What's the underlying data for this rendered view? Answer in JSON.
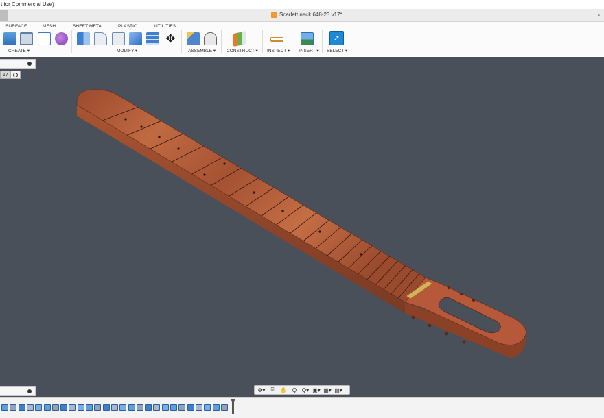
{
  "window": {
    "title_strip": "t for Commercial Use)",
    "doc_title": "Scarlett neck 648-23 v17*",
    "close_glyph": "×"
  },
  "toolbar": {
    "tabs": [
      "SURFACE",
      "MESH",
      "SHEET METAL",
      "PLASTIC",
      "UTILITIES"
    ],
    "groups": [
      "CREATE ▾",
      "MODIFY ▾",
      "ASSEMBLE ▾",
      "CONSTRUCT ▾",
      "INSPECT ▾",
      "INSERT ▾",
      "SELECT ▾"
    ]
  },
  "viewport": {
    "version_label": "17",
    "nav_icons": [
      "orbit-icon",
      "look-icon",
      "pan-icon",
      "zoom-icon",
      "fit-icon",
      "display-icon",
      "grid-icon",
      "viewports-icon"
    ],
    "nav_glyphs": [
      "✥▾",
      "⌸",
      "✋",
      "Q",
      "Q▾",
      "▣▾",
      "▦▾",
      "▤▾"
    ],
    "background": "#49505a"
  },
  "model": {
    "name": "guitar neck",
    "wood_color": "#b5593a",
    "fret_count": 22
  },
  "timeline": {
    "item_count": 27
  }
}
